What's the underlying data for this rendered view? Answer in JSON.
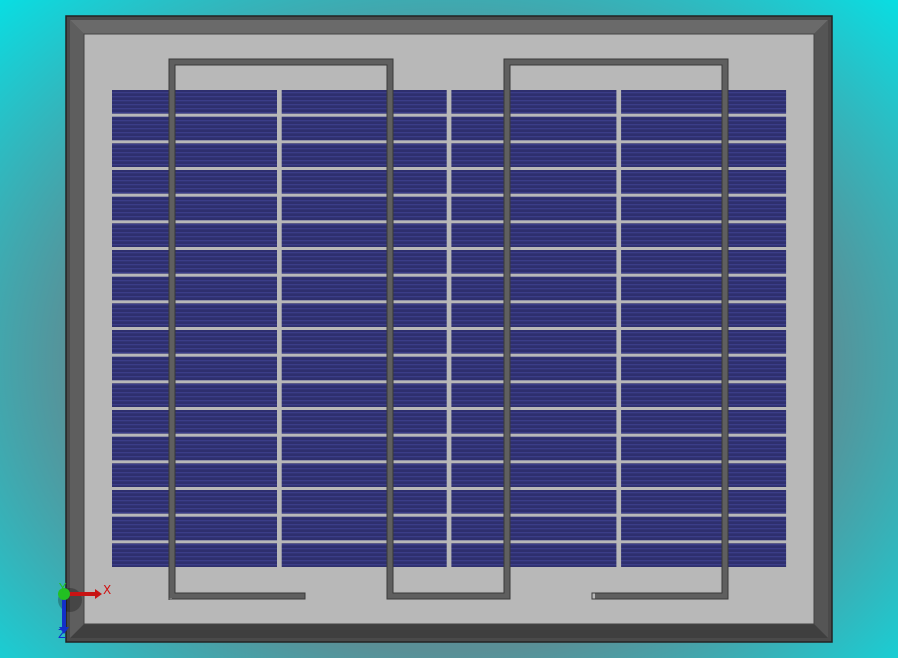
{
  "viewport": {
    "model": "solar-panel",
    "cell_columns": 4,
    "cell_rows": 18,
    "colors": {
      "frame_outer": "#4a4a4a",
      "frame_bevel": "#6c6c6c",
      "backsheet": "#b8b8b8",
      "cell": "#2e2f6e",
      "cell_stripe": "#3a3c86",
      "wire": "#666666"
    }
  },
  "triad": {
    "x_label": "X",
    "y_label": "Y",
    "z_label": "Z",
    "x_color": "#d01010",
    "y_color": "#20c020",
    "z_color": "#1030d0"
  }
}
